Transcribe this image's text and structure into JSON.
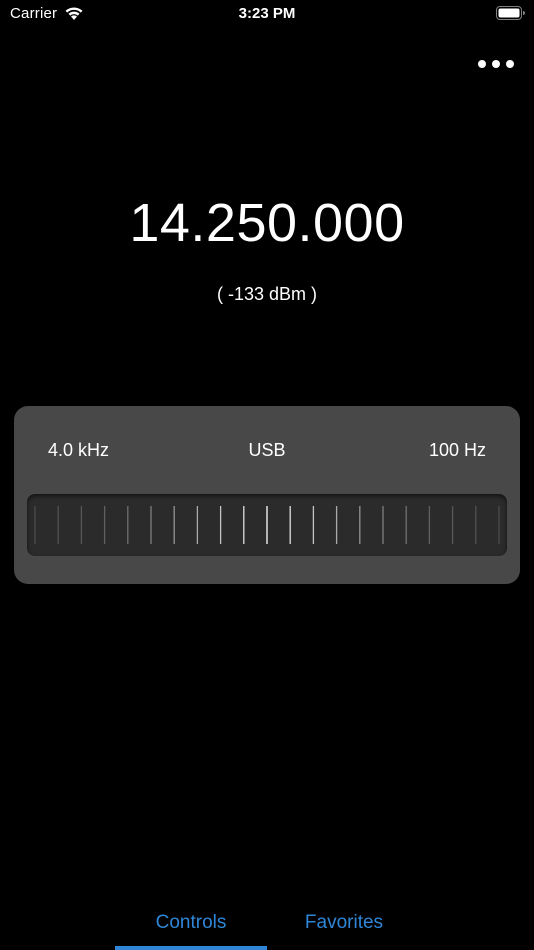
{
  "status_bar": {
    "carrier": "Carrier",
    "time": "3:23 PM"
  },
  "radio": {
    "frequency": "14.250.000",
    "signal": "( -133 dBm )",
    "bandwidth": "4.0 kHz",
    "mode": "USB",
    "step": "100 Hz"
  },
  "tabs": [
    {
      "label": "Controls",
      "selected": true
    },
    {
      "label": "Favorites",
      "selected": false
    }
  ],
  "colors": {
    "accent": "#2f86d6",
    "panel": "#484848",
    "dial": "#2b2b2b"
  },
  "icons": {
    "wifi": "wifi-icon",
    "battery": "battery-icon",
    "more": "more-icon"
  }
}
